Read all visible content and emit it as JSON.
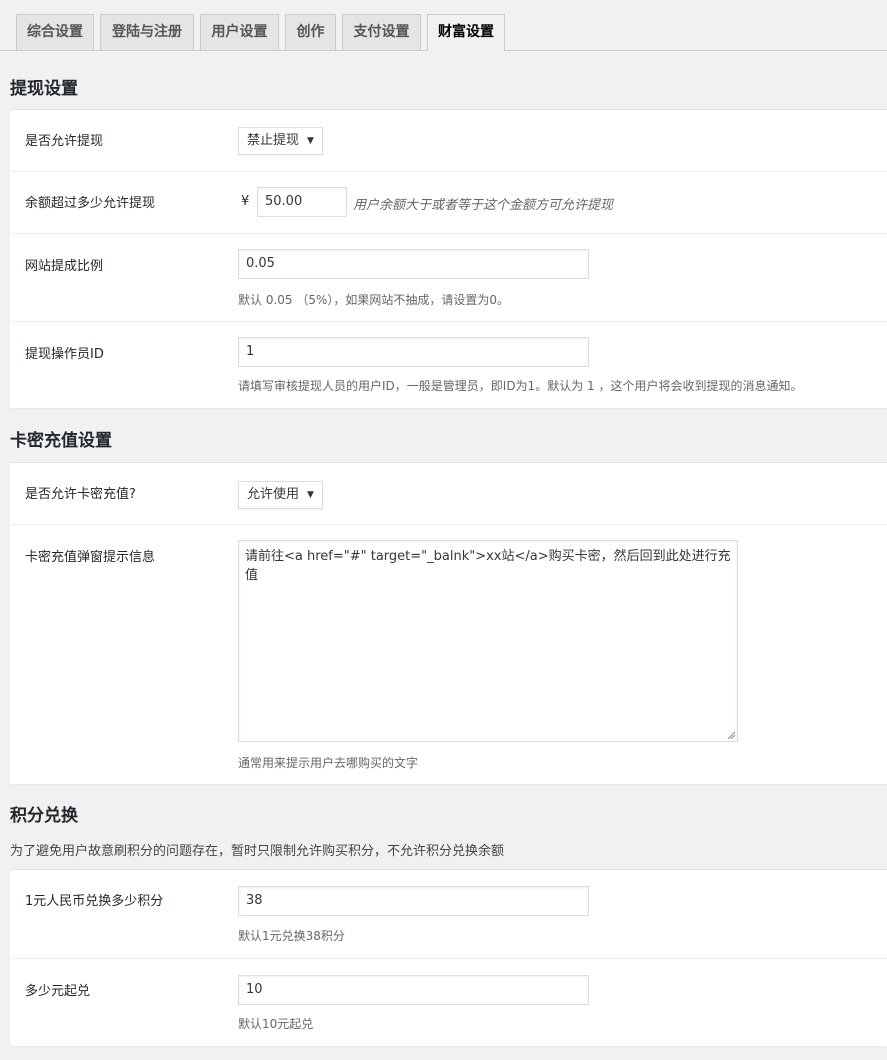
{
  "tabs": [
    {
      "label": "综合设置"
    },
    {
      "label": "登陆与注册"
    },
    {
      "label": "用户设置"
    },
    {
      "label": "创作"
    },
    {
      "label": "支付设置"
    },
    {
      "label": "财富设置"
    }
  ],
  "withdraw": {
    "title": "提现设置",
    "allow_label": "是否允许提现",
    "allow_value": "禁止提现",
    "min_balance_label": "余额超过多少允许提现",
    "currency_symbol": "¥",
    "min_balance_value": "50.00",
    "min_balance_hint": "用户余额大于或者等于这个金额方可允许提现",
    "commission_label": "网站提成比例",
    "commission_value": "0.05",
    "commission_hint": "默认 0.05 （5%），如果网站不抽成，请设置为0。",
    "operator_label": "提现操作员ID",
    "operator_value": "1",
    "operator_hint": "请填写审核提现人员的用户ID，一般是管理员，即ID为1。默认为 1 ，这个用户将会收到提现的消息通知。"
  },
  "card": {
    "title": "卡密充值设置",
    "allow_label": "是否允许卡密充值?",
    "allow_value": "允许使用",
    "popup_label": "卡密充值弹窗提示信息",
    "popup_value": "请前往<a href=\"#\" target=\"_balnk\">xx站</a>购买卡密，然后回到此处进行充值",
    "popup_hint": "通常用来提示用户去哪购买的文字"
  },
  "points": {
    "title": "积分兑换",
    "description": "为了避免用户故意刷积分的问题存在，暂时只限制允许购买积分，不允许积分兑换余额",
    "rate_label": "1元人民币兑换多少积分",
    "rate_value": "38",
    "rate_hint": "默认1元兑换38积分",
    "min_label": "多少元起兑",
    "min_value": "10",
    "min_hint": "默认10元起兑"
  },
  "icons": {
    "select_arrow": "caret-down-icon",
    "resize_handle": "resize-handle-icon"
  }
}
